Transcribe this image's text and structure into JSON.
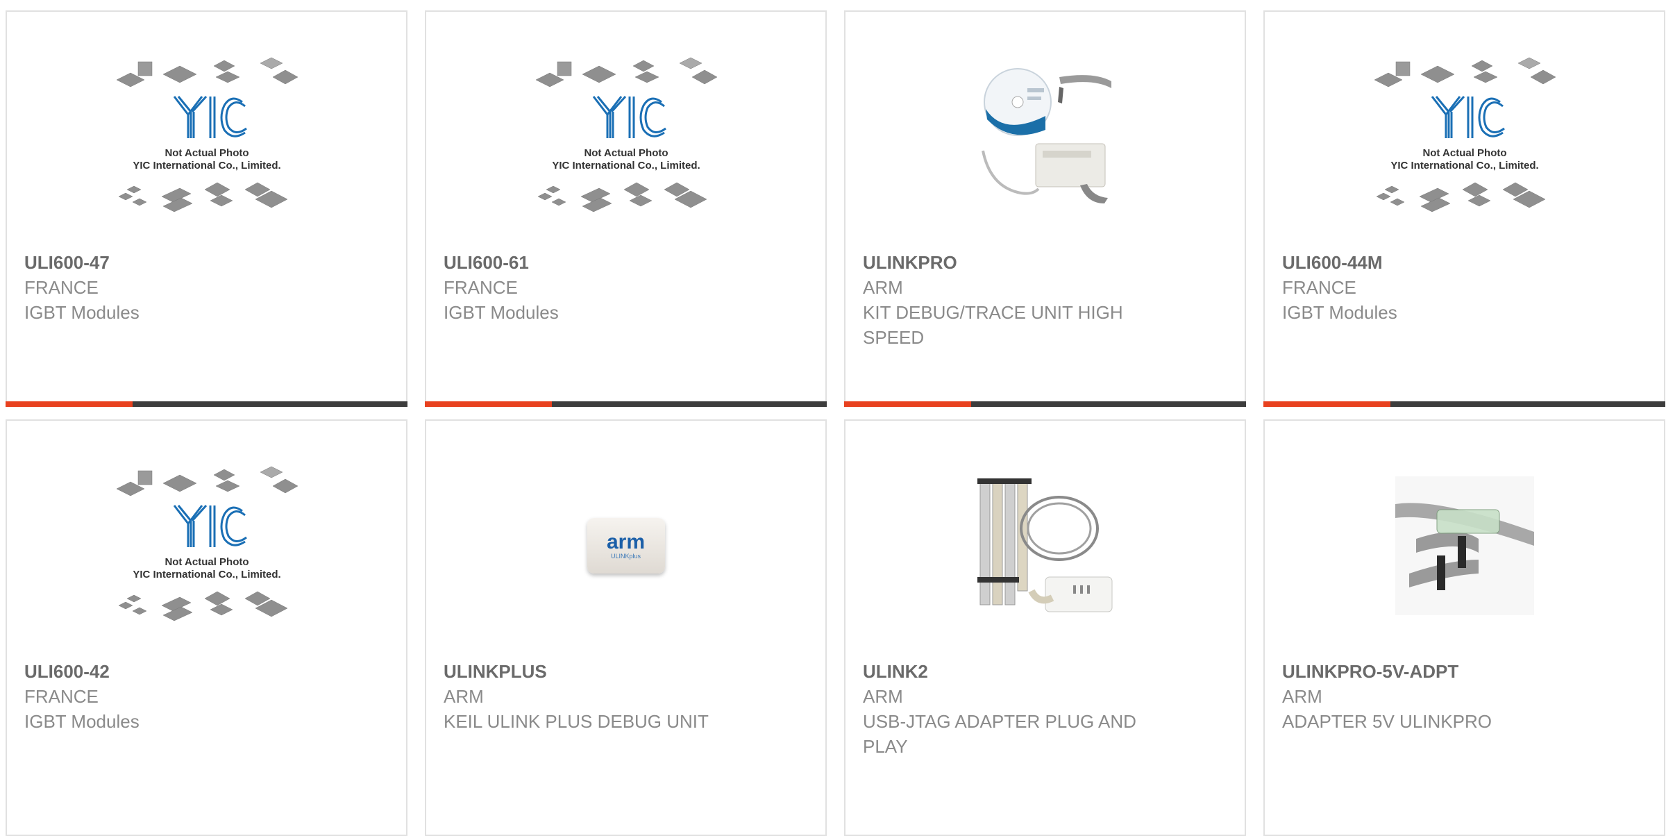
{
  "products": [
    {
      "part": "ULI600-47",
      "manufacturer": "FRANCE",
      "description": "IGBT Modules",
      "image": "yic-placeholder",
      "placeholder_text": [
        "Not Actual Photo",
        "YIC International Co., Limited."
      ],
      "logo_text": "YIC"
    },
    {
      "part": "ULI600-61",
      "manufacturer": "FRANCE",
      "description": "IGBT Modules",
      "image": "yic-placeholder",
      "placeholder_text": [
        "Not Actual Photo",
        "YIC International Co., Limited."
      ],
      "logo_text": "YIC"
    },
    {
      "part": "ULINKPRO",
      "manufacturer": "ARM",
      "description": "KIT DEBUG/TRACE UNIT HIGH SPEED",
      "image": "ulinkpro-kit-photo"
    },
    {
      "part": "ULI600-44M",
      "manufacturer": "FRANCE",
      "description": "IGBT Modules",
      "image": "yic-placeholder",
      "placeholder_text": [
        "Not Actual Photo",
        "YIC International Co., Limited."
      ],
      "logo_text": "YIC"
    },
    {
      "part": "ULI600-42",
      "manufacturer": "FRANCE",
      "description": "IGBT Modules",
      "image": "yic-placeholder",
      "placeholder_text": [
        "Not Actual Photo",
        "YIC International Co., Limited."
      ],
      "logo_text": "YIC"
    },
    {
      "part": "ULINKPLUS",
      "manufacturer": "ARM",
      "description": "KEIL ULINK PLUS DEBUG UNIT",
      "image": "ulinkplus-device-photo",
      "device_text": [
        "arm",
        "ULINKplus"
      ]
    },
    {
      "part": "ULINK2",
      "manufacturer": "ARM",
      "description": "USB-JTAG ADAPTER PLUG AND PLAY",
      "image": "ulink2-kit-photo"
    },
    {
      "part": "ULINKPRO-5V-ADPT",
      "manufacturer": "ARM",
      "description": "ADAPTER 5V ULINKPRO",
      "image": "ribbon-adapter-photo"
    }
  ],
  "colors": {
    "accent": "#e8411f",
    "bar": "#3d3d3d",
    "yic_blue": "#1a6fb5",
    "text_dark": "#6a6a6a",
    "text_light": "#8a8a8a",
    "border": "#e1e1e1"
  }
}
